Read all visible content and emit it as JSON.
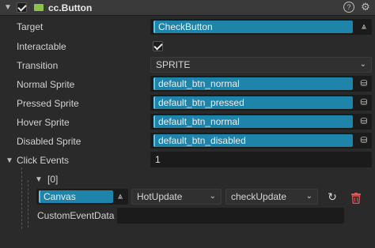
{
  "component": {
    "title": "cc.Button",
    "enabled": true,
    "header_icons": [
      "help-icon",
      "settings-icon"
    ]
  },
  "properties": {
    "target": {
      "label": "Target",
      "value": "CheckButton"
    },
    "interactable": {
      "label": "Interactable",
      "checked": true
    },
    "transition": {
      "label": "Transition",
      "value": "SPRITE"
    },
    "normal_sprite": {
      "label": "Normal Sprite",
      "value": "default_btn_normal"
    },
    "pressed_sprite": {
      "label": "Pressed Sprite",
      "value": "default_btn_pressed"
    },
    "hover_sprite": {
      "label": "Hover Sprite",
      "value": "default_btn_normal"
    },
    "disabled_sprite": {
      "label": "Disabled Sprite",
      "value": "default_btn_disabled"
    }
  },
  "click_events": {
    "label": "Click Events",
    "count": "1",
    "items": [
      {
        "index_label": "[0]",
        "target": "Canvas",
        "component": "HotUpdate",
        "handler": "checkUpdate",
        "custom_label": "CustomEventData",
        "custom_value": ""
      }
    ]
  },
  "colors": {
    "asset_bg": "#1f84a9",
    "component_icon": "#8bc34a",
    "delete_icon": "#e05555"
  }
}
